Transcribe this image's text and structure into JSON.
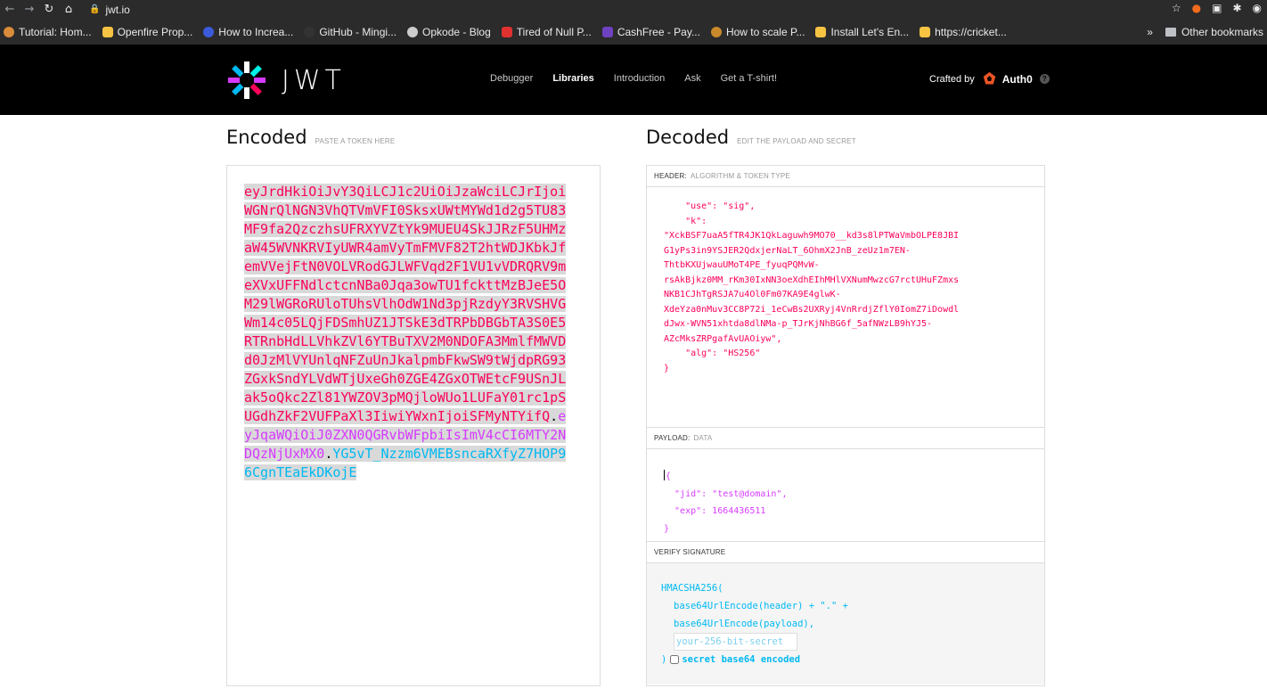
{
  "browser": {
    "url": "jwt.io",
    "bookmarks": [
      {
        "label": "Tutorial: Hom...",
        "color": "#d98c3a"
      },
      {
        "label": "Openfire Prop...",
        "color": "#f6c343"
      },
      {
        "label": "How to Increa...",
        "color": "#3b5bdb"
      },
      {
        "label": "GitHub - Mingi...",
        "color": "#333333"
      },
      {
        "label": "Opkode - Blog",
        "color": "#cccccc"
      },
      {
        "label": "Tired of Null P...",
        "color": "#e03131"
      },
      {
        "label": "CashFree - Pay...",
        "color": "#6f42c1"
      },
      {
        "label": "How to scale P...",
        "color": "#c98a2b"
      },
      {
        "label": "Install Let's En...",
        "color": "#f6c343"
      },
      {
        "label": "https://cricket...",
        "color": "#f6c343"
      }
    ],
    "bookmarks_more": "»",
    "other_bookmarks": "Other bookmarks"
  },
  "site": {
    "logo_text": "JWT",
    "nav": [
      "Debugger",
      "Libraries",
      "Introduction",
      "Ask",
      "Get a T-shirt!"
    ],
    "nav_active": "Libraries",
    "crafted_by": "Crafted by",
    "brand": "Auth0",
    "help": "?"
  },
  "encoded": {
    "title": "Encoded",
    "subtitle": "PASTE A TOKEN HERE",
    "token_header": "eyJrdHkiOiJvY3QiLCJ1c2UiOiJzaWciLCJrIjoiWGNrQlNGN3VhQTVmVFI0SksxUWtMYWd1d2g5TU83MF9fa2QzczhsUFRXYVZtYk9MUEU4SkJJRzF5UHMzaW45WVNKRVIyUWR4amVyTmFMVF82T2htWDJKbkJfemVVejFtN0VOLVRodGJLWFVqd2F1VU1vVDRQRV9meXVxUFFNdlctcnNBa0Jqa3owTU1fckttMzBJeE5OM29lWGRoRUloTUhsVlhOdW1Nd3pjRzdyY3RVSHVGWm14c05LQjFDSmhUZ1JTSkE3dTRPbDBGbTA3S0E5RTRnbHdLLVhkZVl6YTBuTXV2M0NDOFA3MmlfMWVDd0JzMlVYUnlqNFZuUnJkalpmbFkwSW9tWjdpRG93ZGxkSndYLVdWTjUxeGh0ZGE4ZGxOTWEtcF9USnJLak5oQkc2Zl81YWZOV3pMQjloWUo1LUFaY01rc1pSUGdhZkF2VUFPaXl3IiwiYWxnIjoiSFMyNTYifQ",
    "token_dot1": ".",
    "token_payload": "eyJqaWQiOiJ0ZXN0QGRvbWFpbiIsImV4cCI6MTY2NDQzNjUxMX0",
    "token_dot2": ".",
    "token_signature": "YG5vT_Nzzm6VMEBsncaRXfyZ7HOP96CgnTEaEkDKojE"
  },
  "decoded": {
    "title": "Decoded",
    "subtitle": "EDIT THE PAYLOAD AND SECRET",
    "header_label": "HEADER:",
    "header_desc": "ALGORITHM & TOKEN TYPE",
    "header_code": "    \"use\": \"sig\",\n    \"k\":\n\"XckBSF7uaA5fTR4JK1QkLaguwh9MO70__kd3s8lPTWaVmbOLPE8JBI\nG1yPs3in9YSJER2QdxjerNaLT_6OhmX2JnB_zeUz1m7EN-\nThtbKXUjwauUMoT4PE_fyuqPQMvW-\nrsAkBjkz0MM_rKm30IxNN3oeXdhEIhMHlVXNumMwzcG7rctUHuFZmxs\nNKB1CJhTgRSJA7u4Ol0Fm07KA9E4glwK-\nXdeYza0nMuv3CC8P72i_1eCwBs2UXRyj4VnRrdjZflY0IomZ7iDowdl\ndJwx-WVN51xhtda8dlNMa-p_TJrKjNhBG6f_5afNWzLB9hYJ5-\nAZcMksZRPgafAvUAOiyw\",\n    \"alg\": \"HS256\"\n}",
    "payload_label": "PAYLOAD:",
    "payload_desc": "DATA",
    "payload_code": "{\n  \"jid\": \"test@domain\",\n  \"exp\": 1664436511\n}",
    "verify_label": "VERIFY SIGNATURE",
    "verify_fn": "HMACSHA256(",
    "verify_line1": "base64UrlEncode(header) + \".\" +",
    "verify_line2": "base64UrlEncode(payload),",
    "secret_placeholder": "your-256-bit-secret",
    "verify_close": ")",
    "secret_b64_label": "secret base64 encoded"
  },
  "colors": {
    "header": "#fb015b",
    "payload": "#d63aff",
    "signature": "#00b9f1"
  }
}
